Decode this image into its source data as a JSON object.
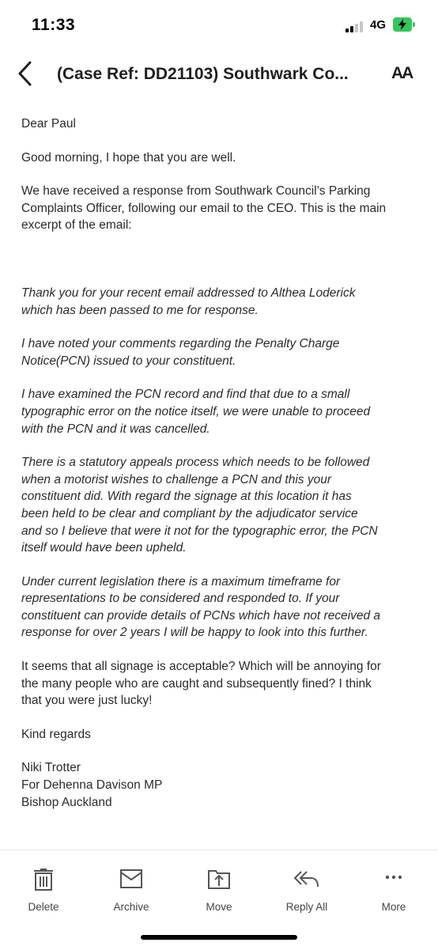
{
  "status": {
    "time": "11:33",
    "network": "4G"
  },
  "nav": {
    "subject": "(Case Ref: DD21103) Southwark Co...",
    "text_size_label": "AA"
  },
  "email": {
    "greeting": "Dear Paul",
    "intro": "Good morning, I hope that you are well.",
    "context": [
      "We have received a response from Southwark Council’s Parking",
      "Complaints Officer, following our email to the CEO. This is the main",
      "excerpt of the email:"
    ],
    "quote_p1": [
      "Thank you for your recent email addressed to Althea Loderick",
      "which has been passed to me for response."
    ],
    "quote_p2": [
      "I have noted your comments regarding the Penalty Charge",
      "Notice(PCN) issued to your constituent."
    ],
    "quote_p3": [
      "I have examined the PCN record and find that due to a small",
      "typographic error on the notice itself, we were unable to proceed",
      "with the PCN and it was cancelled."
    ],
    "quote_p4": [
      "There is a statutory appeals process which needs to be followed",
      "when a motorist wishes to challenge a PCN and this your",
      "constituent did. With regard the signage at this location it has",
      "been held to be clear and compliant by the adjudicator service",
      "and so I believe that were it not for the typographic error, the PCN",
      "itself would have been upheld."
    ],
    "quote_p5": [
      "Under current legislation there is a maximum timeframe for",
      "representations to be considered and responded to. If your",
      "constituent can provide details of PCNs which have not received a",
      "response for over 2 years I will be happy to look into this further."
    ],
    "comment": [
      "It seems that all signage is acceptable? Which will be annoying for",
      "the many people who are caught and subsequently fined? I think",
      "that you were just lucky!"
    ],
    "signoff": "Kind regards",
    "signature": [
      "Niki Trotter",
      "For Dehenna Davison MP",
      "Bishop Auckland"
    ]
  },
  "toolbar": {
    "delete": "Delete",
    "archive": "Archive",
    "move": "Move",
    "reply_all": "Reply All",
    "more": "More"
  },
  "colors": {
    "battery": "#35c759",
    "text": "#2a2a2a",
    "icon": "#555555"
  }
}
